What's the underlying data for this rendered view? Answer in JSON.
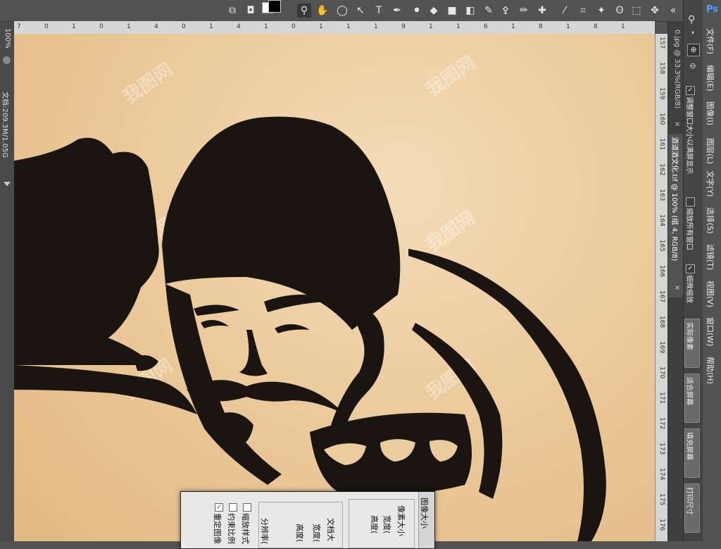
{
  "app": {
    "logo": "Ps"
  },
  "menu": {
    "file": "文件(F)",
    "edit": "编辑(E)",
    "image": "图像(I)",
    "layer": "图层(L)",
    "type": "文字(Y)",
    "select": "选择(S)",
    "filter": "滤镜(T)",
    "view": "视图(V)",
    "window": "窗口(W)",
    "help": "帮助(H)"
  },
  "zoom_options": {
    "resize_windows": "调整窗口大小以满屏显示",
    "zoom_all": "缩放所有窗口",
    "scrubby_zoom": "细微缩放",
    "resize_checked": true,
    "zoom_all_checked": false,
    "scrubby_checked": true,
    "actual_pixels": "实际像素",
    "fit_screen": "适合屏幕",
    "fill_screen": "填充屏幕",
    "print_size": "打印尺寸"
  },
  "tabs": [
    {
      "label": "0.jpg @ 33.3%(RGB/8)",
      "close": "×"
    },
    {
      "label": "酒道酒文化.tif @ 100% (组 4, RGB/8)",
      "close": "×"
    }
  ],
  "status": {
    "zoom": "100%",
    "doc_size": "文档:209.3M/1.05G"
  },
  "rulers": {
    "top": [
      "7",
      "0",
      "1",
      "0",
      "1",
      "4",
      "0",
      "1",
      "4",
      "1",
      "0",
      "1",
      "1",
      "1",
      "9",
      "1",
      "1",
      "6",
      "1",
      "8",
      "1",
      "8",
      "1"
    ],
    "right": [
      "157",
      "158",
      "159",
      "160",
      "161",
      "162",
      "163",
      "164",
      "165",
      "166",
      "167",
      "168",
      "169",
      "170",
      "171",
      "172",
      "173",
      "174",
      "175",
      "176"
    ]
  },
  "canvas": {
    "watermark": "我图网"
  },
  "dialog": {
    "title": "图像大小",
    "pixel_dims": "像素大小",
    "width": "宽度(",
    "height": "高度(",
    "doc_size": "文档大",
    "doc_width": "宽度(",
    "doc_height": "高度(",
    "resolution": "分辨率(",
    "scale_styles": "缩放样式",
    "constrain": "约束比例",
    "resample": "重定图像",
    "scale_checked": false,
    "constrain_checked": false,
    "resample_checked": true
  },
  "colors": {
    "ui_bg": "#535353",
    "canvas": "#eccb9c",
    "ink": "#1a1510"
  }
}
